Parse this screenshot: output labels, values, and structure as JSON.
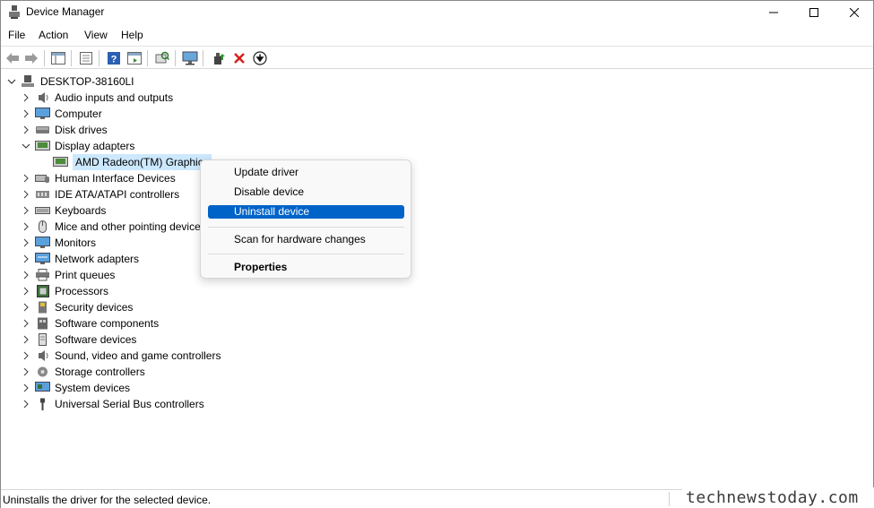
{
  "window": {
    "title": "Device Manager"
  },
  "menubar": {
    "items": [
      "File",
      "Action",
      "View",
      "Help"
    ]
  },
  "toolbar": {
    "buttons": [
      "back-icon",
      "forward-icon",
      "show-hide-console-tree-icon",
      "properties-icon",
      "help-icon",
      "action-pane-icon",
      "scan-hardware-icon",
      "monitor-icon",
      "update-driver-icon",
      "uninstall-icon",
      "download-icon"
    ]
  },
  "tree": {
    "root": "DESKTOP-38160LI",
    "categories": [
      {
        "label": "Audio inputs and outputs",
        "icon": "speaker-icon"
      },
      {
        "label": "Computer",
        "icon": "computer-icon"
      },
      {
        "label": "Disk drives",
        "icon": "disk-drive-icon"
      },
      {
        "label": "Display adapters",
        "icon": "display-adapter-icon",
        "expanded": true
      },
      {
        "label": "Human Interface Devices",
        "icon": "hid-icon"
      },
      {
        "label": "IDE ATA/ATAPI controllers",
        "icon": "ide-controller-icon"
      },
      {
        "label": "Keyboards",
        "icon": "keyboard-icon"
      },
      {
        "label": "Mice and other pointing devices",
        "icon": "mouse-icon"
      },
      {
        "label": "Monitors",
        "icon": "monitor-icon"
      },
      {
        "label": "Network adapters",
        "icon": "network-adapter-icon"
      },
      {
        "label": "Print queues",
        "icon": "printer-icon"
      },
      {
        "label": "Processors",
        "icon": "processor-icon"
      },
      {
        "label": "Security devices",
        "icon": "security-device-icon"
      },
      {
        "label": "Software components",
        "icon": "software-component-icon"
      },
      {
        "label": "Software devices",
        "icon": "software-device-icon"
      },
      {
        "label": "Sound, video and game controllers",
        "icon": "sound-icon"
      },
      {
        "label": "Storage controllers",
        "icon": "storage-controller-icon"
      },
      {
        "label": "System devices",
        "icon": "system-device-icon"
      },
      {
        "label": "Universal Serial Bus controllers",
        "icon": "usb-icon"
      }
    ],
    "selected_child": "AMD Radeon(TM) Graphics"
  },
  "context_menu": {
    "items": [
      "Update driver",
      "Disable device",
      "Uninstall device",
      "Scan for hardware changes",
      "Properties"
    ],
    "highlighted": "Uninstall device"
  },
  "statusbar": {
    "text": "Uninstalls the driver for the selected device."
  },
  "watermark": {
    "text": "technewstoday.com"
  },
  "colors": {
    "highlight": "#0063c8",
    "selection": "#cce8ff"
  }
}
